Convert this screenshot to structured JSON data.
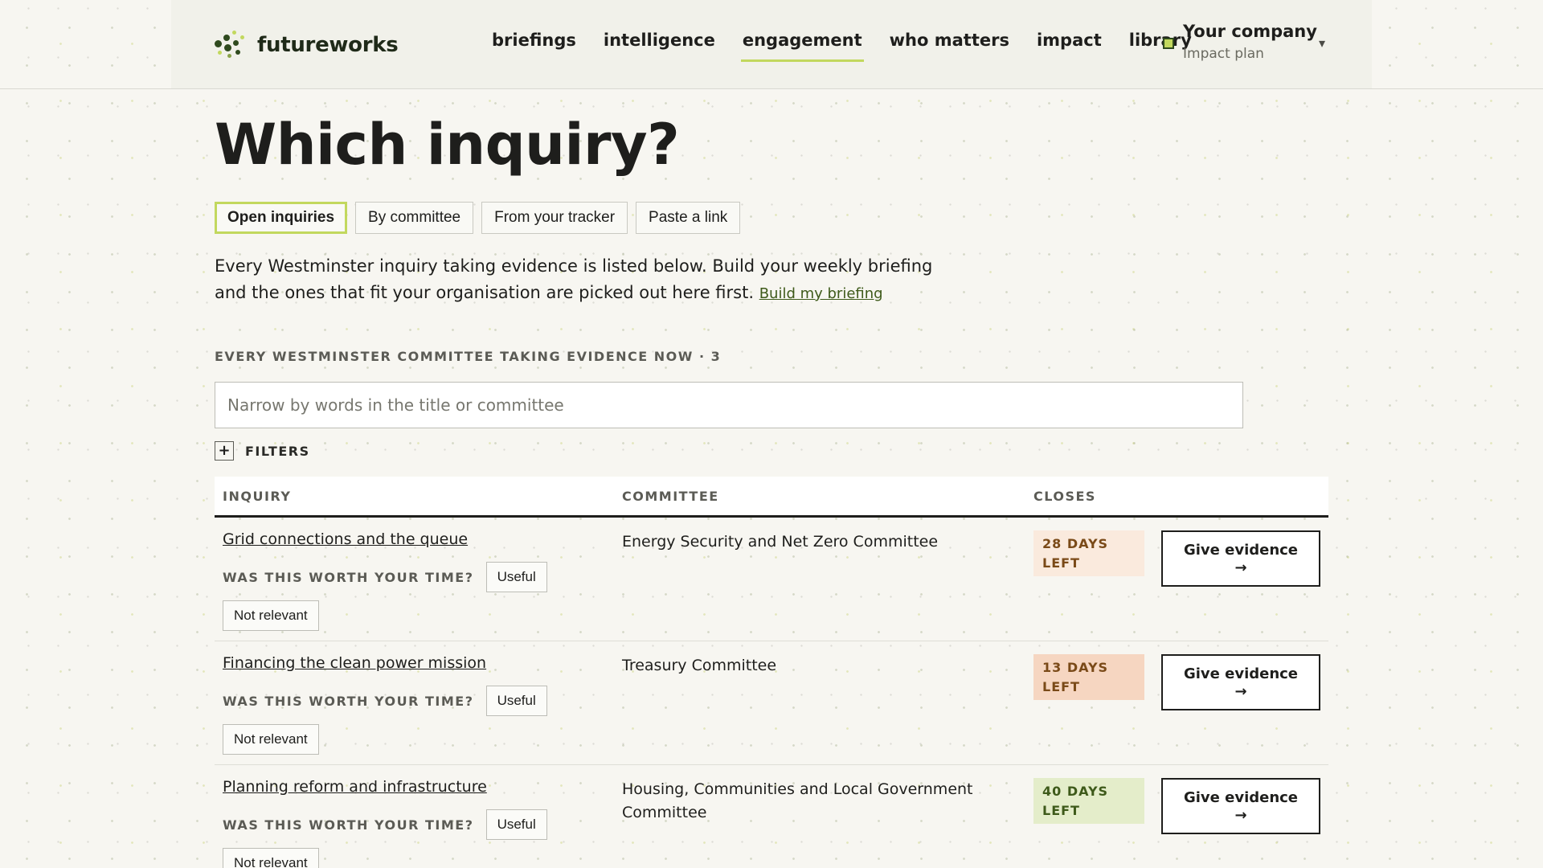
{
  "header": {
    "brand": "futureworks",
    "nav": [
      {
        "label": "briefings",
        "active": false
      },
      {
        "label": "intelligence",
        "active": false
      },
      {
        "label": "engagement",
        "active": true
      },
      {
        "label": "who matters",
        "active": false
      },
      {
        "label": "impact",
        "active": false
      },
      {
        "label": "library",
        "active": false
      }
    ],
    "company_name": "Your company",
    "company_sub": "Impact plan",
    "company_caret": "▾"
  },
  "page": {
    "title": "Which inquiry?",
    "tabs": [
      {
        "label": "Open inquiries",
        "active": true
      },
      {
        "label": "By committee",
        "active": false
      },
      {
        "label": "From your tracker",
        "active": false
      },
      {
        "label": "Paste a link",
        "active": false
      }
    ],
    "intro_text": "Every Westminster inquiry taking evidence is listed below. Build your weekly briefing and the ones that fit your organisation are picked out here first.",
    "intro_link": "Build my briefing",
    "section_label": "EVERY WESTMINSTER COMMITTEE TAKING EVIDENCE NOW · 3",
    "search_placeholder": "Narrow by words in the title or committee",
    "filters_icon": "+",
    "filters_label": "FILTERS"
  },
  "table": {
    "headers": {
      "inquiry": "INQUIRY",
      "committee": "COMMITTEE",
      "closes": "CLOSES"
    },
    "feedback_question": "WAS THIS WORTH YOUR TIME?",
    "useful_label": "Useful",
    "not_relevant_label": "Not relevant",
    "evidence_label": "Give evidence",
    "evidence_arrow": "→",
    "rows": [
      {
        "title": "Grid connections and the queue",
        "committee": "Energy Security and Net Zero Committee",
        "closes_line1": "28 DAYS",
        "closes_line2": "LEFT",
        "urgency": "warm"
      },
      {
        "title": "Financing the clean power mission",
        "committee": "Treasury Committee",
        "closes_line1": "13 DAYS",
        "closes_line2": "LEFT",
        "urgency": "urgent"
      },
      {
        "title": "Planning reform and infrastructure",
        "committee": "Housing, Communities and Local Government Committee",
        "closes_line1": "40 DAYS",
        "closes_line2": "LEFT",
        "urgency": "calm"
      }
    ]
  },
  "colors": {
    "accent": "#c2d85e",
    "brand_dark": "#2f4a1e",
    "badge_warm": "#faeadd",
    "badge_urgent": "#f6d6c1",
    "badge_calm": "#e4edca"
  }
}
